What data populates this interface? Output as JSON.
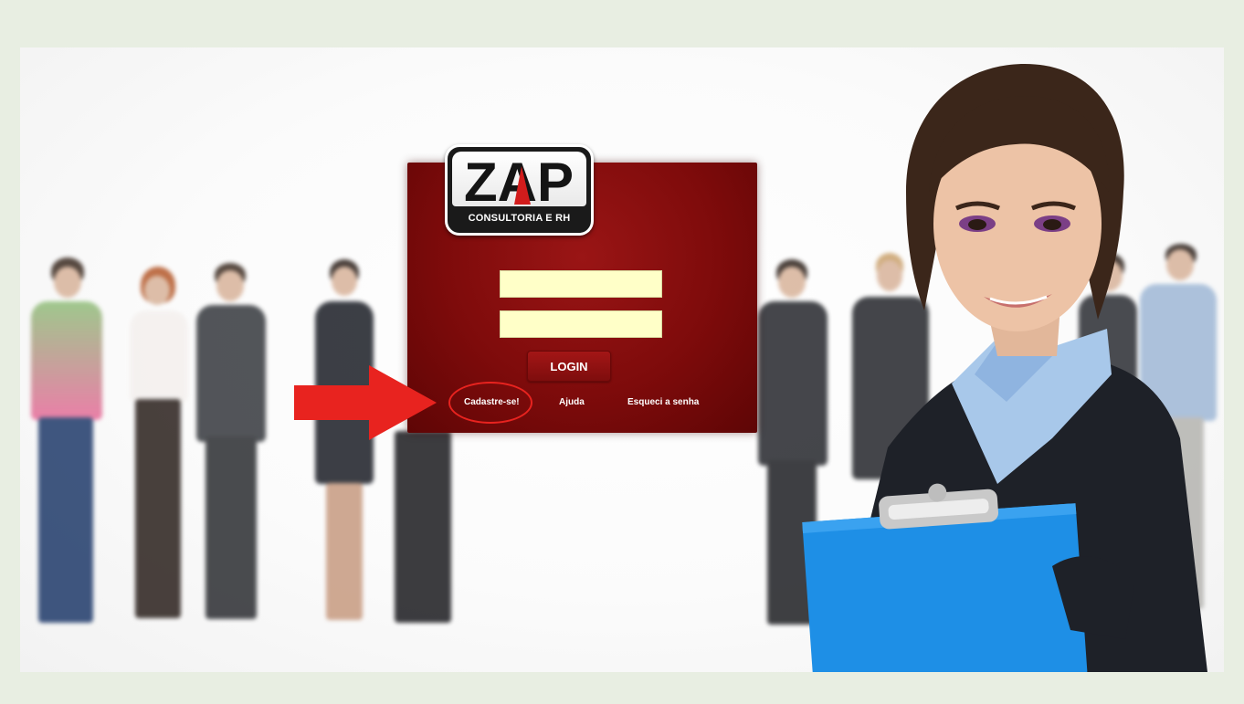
{
  "logo": {
    "wordmark": "ZAP",
    "subtitle": "CONSULTORIA E RH"
  },
  "login_form": {
    "username_value": "",
    "password_value": "",
    "login_label": "LOGIN"
  },
  "links": {
    "register": "Cadastre-se!",
    "help": "Ajuda",
    "forgot_password": "Esqueci a senha"
  },
  "colors": {
    "card_red": "#7e0b0b",
    "field_yellow": "#ffffc8",
    "annotation_red": "#e8231f",
    "clipboard_blue": "#1e8fe6"
  },
  "annotations": {
    "arrow_icon": "right-arrow-icon",
    "circle_highlight": "register-link"
  }
}
